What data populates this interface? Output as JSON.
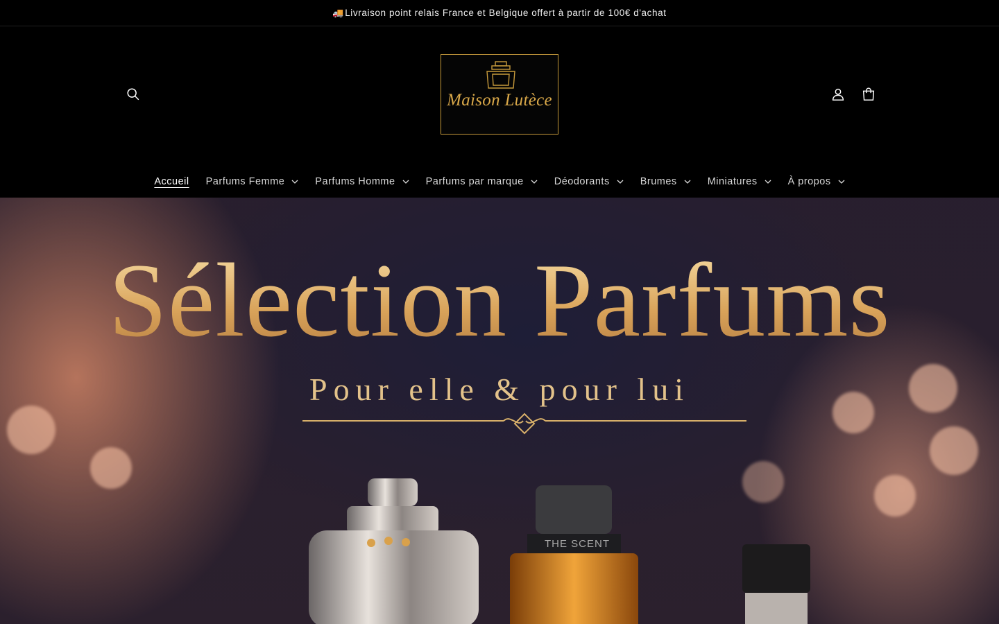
{
  "announcement": {
    "icon": "truck-icon",
    "emoji": "🚚",
    "text": "Livraison point relais France et Belgique offert à partir de 100€ d'achat"
  },
  "header": {
    "logo_text": "Maison Lutèce",
    "search_icon": "search-icon",
    "account_icon": "user-icon",
    "cart_icon": "bag-icon"
  },
  "nav": {
    "items": [
      {
        "label": "Accueil",
        "dropdown": false,
        "active": true
      },
      {
        "label": "Parfums Femme",
        "dropdown": true
      },
      {
        "label": "Parfums Homme",
        "dropdown": true
      },
      {
        "label": "Parfums par marque",
        "dropdown": true
      },
      {
        "label": "Déodorants",
        "dropdown": true
      },
      {
        "label": "Brumes",
        "dropdown": true
      },
      {
        "label": "Miniatures",
        "dropdown": true
      },
      {
        "label": "À propos",
        "dropdown": true
      }
    ]
  },
  "hero": {
    "title": "Sélection Parfums",
    "subtitle": "Pour elle & pour lui",
    "bottle_label": "THE SCENT"
  },
  "colors": {
    "gold": "#c89b3c",
    "background": "#000000"
  }
}
